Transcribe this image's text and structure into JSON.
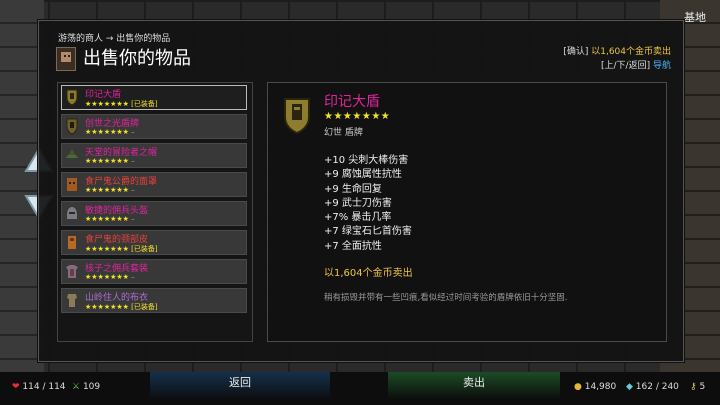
{
  "location": "基地",
  "breadcrumb": "游荡的商人 → 出售你的物品",
  "title": "出售你的物品",
  "hints": {
    "confirm_key": "[确认]",
    "confirm_text": "以1,604个金币卖出",
    "nav_key": "[上/下/返回]",
    "nav_text": "导航"
  },
  "items": [
    {
      "name": "印记大盾",
      "stars": "★★★★★★★",
      "tag": "[已装备]",
      "color": "#e1239e",
      "selected": true,
      "icon": "shield-icon"
    },
    {
      "name": "创世之光盾牌",
      "stars": "★★★★★★★",
      "tag": "–",
      "color": "#e1239e",
      "icon": "shield-icon"
    },
    {
      "name": "天堂的冒险者之帽",
      "stars": "★★★★★★★",
      "tag": "–",
      "color": "#e1239e",
      "icon": "hat-icon"
    },
    {
      "name": "食尸鬼公爵的面罩",
      "stars": "★★★★★★★",
      "tag": "–",
      "color": "#e8403a",
      "icon": "mask-icon"
    },
    {
      "name": "敏捷的佣兵头盔",
      "stars": "★★★★★★★",
      "tag": "–",
      "color": "#e1239e",
      "icon": "helmet-icon"
    },
    {
      "name": "食尸鬼的颈部皮",
      "stars": "★★★★★★★",
      "tag": "[已装备]",
      "color": "#e8403a",
      "icon": "neck-icon"
    },
    {
      "name": "核子之佣兵套装",
      "stars": "★★★★★★★",
      "tag": "–",
      "color": "#e1239e",
      "icon": "armor-icon"
    },
    {
      "name": "山岭住人的布衣",
      "stars": "★★★★★★★",
      "tag": "[已装备]",
      "color": "#b06ad8",
      "icon": "cloth-icon"
    }
  ],
  "pager": "• • •",
  "detail": {
    "name": "印记大盾",
    "stars": "★★★★★★★",
    "type": "幻世 盾牌",
    "stats": [
      "+10 尖刺大棒伤害",
      "+9 腐蚀属性抗性",
      "+9 生命回复",
      "+9 武士刀伤害",
      "+7% 暴击几率",
      "+7 绿宝石匕首伤害",
      "+7 全面抗性"
    ],
    "price": "以1,604个金币卖出",
    "description": "稍有损毁并带有一些凹痕,看似经过时间考验的盾牌依旧十分坚固."
  },
  "bottom": {
    "hp": "114 / 114",
    "stamina": "109",
    "back_label": "返回",
    "sell_label": "卖出",
    "gold": "14,980",
    "gems": "162 / 240",
    "keys": "5"
  },
  "colors": {
    "legendary": "#e1239e",
    "gold": "#f0c445",
    "stars": "#f2e12c",
    "nav_blue": "#4cb4ff"
  }
}
